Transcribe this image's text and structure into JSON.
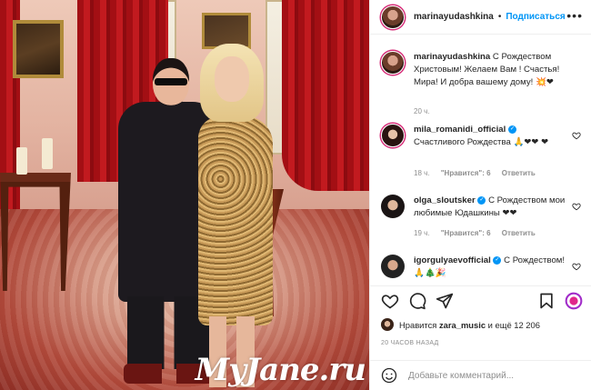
{
  "post": {
    "username": "marinayudashkina",
    "follow_label": "Подписаться",
    "dot": "•"
  },
  "caption": {
    "username": "marinayudashkina",
    "text": "С Рождеством Христовым! Желаем Вам ! Счастья! Мира! И добра вашему дому! 💥❤",
    "time": "20 ч."
  },
  "comments": [
    {
      "username": "mila_romanidi_official",
      "verified": true,
      "text": "Счастливого Рождества 🙏❤❤ ❤",
      "time": "18 ч.",
      "likes": "\"Нравится\": 6",
      "reply": "Ответить"
    },
    {
      "username": "olga_sloutsker",
      "verified": true,
      "text": "С Рождеством мои любимые Юдашкины ❤❤",
      "time": "19 ч.",
      "likes": "\"Нравится\": 6",
      "reply": "Ответить"
    },
    {
      "username": "igorgulyaevofficial",
      "verified": true,
      "text": "С Рождеством! 🙏🎄🎉",
      "time": "",
      "likes": "",
      "reply": ""
    }
  ],
  "likes": {
    "prefix": "Нравится",
    "user": "zara_music",
    "suffix": "и ещё 12 206"
  },
  "timestamp": "20 ЧАСОВ НАЗАД",
  "add_comment_placeholder": "Добавьте комментарий...",
  "watermark": "MyJane.ru",
  "colors": {
    "link": "#0095f6",
    "story_ring": "#d62976",
    "heart": "#ed1c24"
  }
}
